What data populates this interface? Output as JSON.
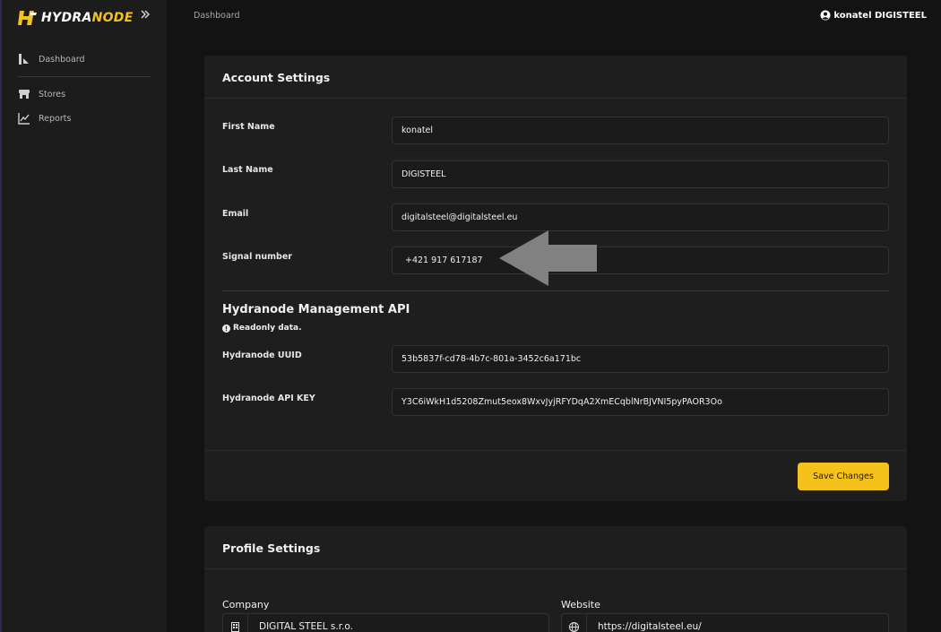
{
  "brand": {
    "name_prefix": "HYDRA",
    "name_suffix": "NODE",
    "accent_color": "#f5c21b"
  },
  "sidebar": {
    "collapse_icon": "double-chevron-right-icon",
    "items": [
      {
        "label": "Dashboard",
        "icon": "dashboard-icon"
      },
      {
        "label": "Stores",
        "icon": "store-icon"
      },
      {
        "label": "Reports",
        "icon": "chart-icon"
      }
    ]
  },
  "header": {
    "breadcrumb": "Dashboard",
    "user_name": "konatel DIGISTEEL",
    "user_icon": "user-circle-icon"
  },
  "account_settings": {
    "title": "Account Settings",
    "fields": [
      {
        "label": "First Name",
        "value": "konatel"
      },
      {
        "label": "Last Name",
        "value": "DIGISTEEL"
      },
      {
        "label": "Email",
        "value": "digitalsteel@digitalsteel.eu"
      },
      {
        "label": "Signal number",
        "value": "+421 917 617187"
      }
    ],
    "api": {
      "title": "Hydranode Management API",
      "readonly_note": "Readonly data.",
      "fields": [
        {
          "label": "Hydranode UUID",
          "value": "53b5837f-cd78-4b7c-801a-3452c6a171bc"
        },
        {
          "label": "Hydranode API KEY",
          "value": "Y3C6iWkH1d5208Zmut5eox8WxvJyjRFYDqA2XmECqblNrBJVNI5pyPAOR3Oo"
        }
      ]
    },
    "save_label": "Save Changes"
  },
  "profile_settings": {
    "title": "Profile Settings",
    "company_label": "Company",
    "company_value": "DIGITAL STEEL s.r.o.",
    "website_label": "Website",
    "website_value": "https://digitalsteel.eu/"
  }
}
